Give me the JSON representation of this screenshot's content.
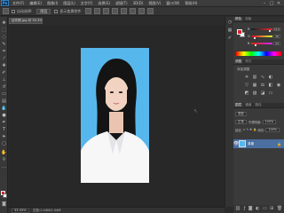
{
  "app": {
    "logo": "Ps"
  },
  "menu": [
    "文件(F)",
    "编辑(E)",
    "图像(I)",
    "图层(L)",
    "文字(Y)",
    "选择(S)",
    "滤镜(T)",
    "3D(D)",
    "视图(V)",
    "窗口(W)",
    "帮助(H)"
  ],
  "window_controls": [
    "–",
    "□",
    "✕"
  ],
  "options_bar": {
    "auto_select_label": "自动选择:",
    "auto_select_value": "图层",
    "show_transform_label": "显示变换控件"
  },
  "document_tab": {
    "title": "证件照.jpg @ 33.3%(RGB/8)"
  },
  "status_bar": {
    "zoom": "33.33%",
    "doc_info": "文档:1.04M/1.04M"
  },
  "panels": {
    "color": {
      "tab_color": "颜色",
      "tab_swatches": "色板",
      "sliders": [
        {
          "label": "R",
          "value": "216"
        },
        {
          "label": "G",
          "value": "38"
        },
        {
          "label": "B",
          "value": "44"
        }
      ],
      "foreground": "#d8262c",
      "background": "#ffffff"
    },
    "adjustments": {
      "tab_adjustments": "调整",
      "tab_styles": "样式",
      "title": "添加调整"
    },
    "layers": {
      "tab_layers": "图层",
      "tab_channels": "通道",
      "tab_paths": "路径",
      "kind_filter": "类型",
      "blend_mode": "正常",
      "opacity_label": "不透明度:",
      "opacity_value": "100%",
      "lock_label": "锁定:",
      "fill_label": "填充:",
      "fill_value": "100%",
      "layer_name": "背景",
      "footer_icons": [
        "link-icon",
        "fx-icon",
        "mask-icon",
        "adjustment-layer-icon",
        "group-icon",
        "new-layer-icon",
        "trash-icon"
      ]
    }
  },
  "colors": {
    "photo_background": "#56b7ec",
    "selected_layer": "#4a6fa0"
  }
}
